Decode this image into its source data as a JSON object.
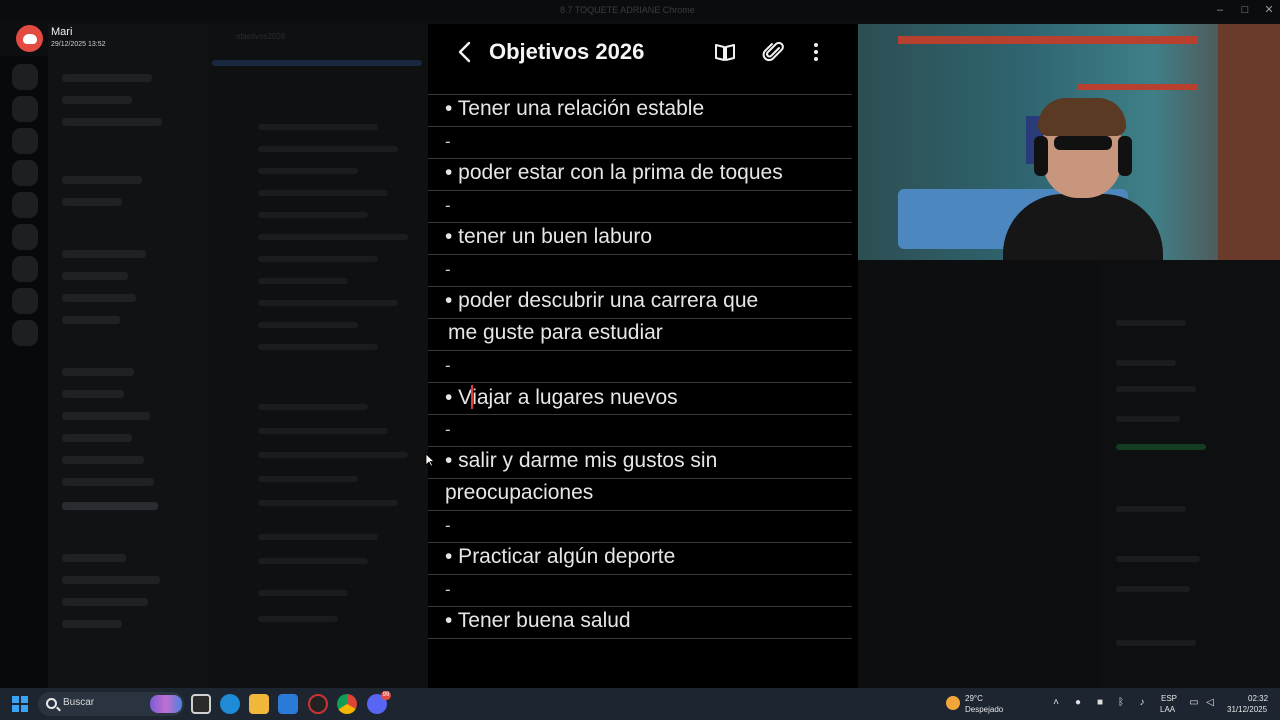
{
  "discord": {
    "user_name": "Mari",
    "user_date": "29/12/2025 13:52",
    "channel_title": "objetivos2026",
    "window_title": "8.7 TOQUETE ADRIANE Chrome"
  },
  "notes": {
    "title": "Objetivos 2026",
    "separator": "-",
    "items": [
      "• Tener una relación estable",
      "• poder estar con la prima de toques",
      "• tener un buen laburo",
      "• poder descubrir una carrera que",
      " me guste para estudiar",
      "• V",
      "iajar a lugares nuevos",
      "• salir y darme mis gustos sin",
      "preocupaciones",
      "• Practicar algún deporte",
      "• Tener buena salud"
    ]
  },
  "taskbar": {
    "search_label": "Buscar",
    "discord_badge": "99",
    "weather_temp": "29°C",
    "weather_desc": "Despejado",
    "lang_line1": "ESP",
    "lang_line2": "LAA",
    "time": "02:32",
    "date": "31/12/2025"
  },
  "colors": {
    "background": "#000000",
    "caret": "#e53935",
    "discord_red": "#e24a42",
    "taskbar": "#1c2530"
  }
}
